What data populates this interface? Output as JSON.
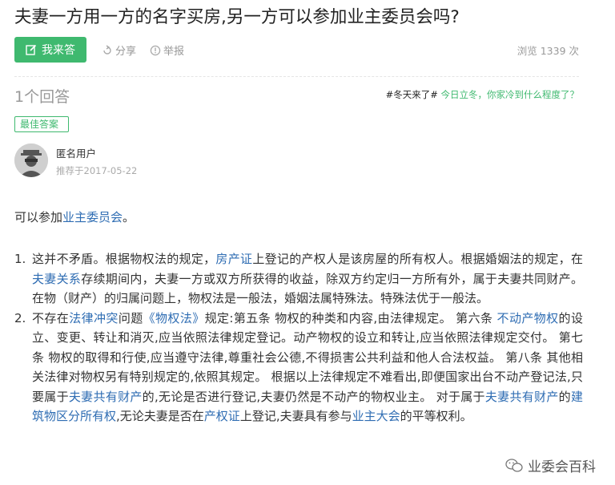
{
  "question": {
    "title": "夫妻一方用一方的名字买房,另一方可以参加业主委员会吗?"
  },
  "toolbar": {
    "answer_label": "我来答",
    "share_label": "分享",
    "report_label": "举报",
    "views_label": "浏览 1339 次"
  },
  "answers": {
    "count_label": "1个回答",
    "topic_tag": "#冬天来了#",
    "topic_link": "今日立冬，你家冷到什么程度了？",
    "best_label": "最佳答案",
    "user": "匿名用户",
    "date": "推荐于2017-05-22"
  },
  "content": {
    "intro_pre": "可以参加",
    "intro_link": "业主委员会",
    "intro_post": "。",
    "item1": {
      "num": "1.",
      "t1": "这并不矛盾。根据物权法的规定，",
      "l1": "房产证",
      "t2": "上登记的产权人是该房屋的所有权人。根据婚姻法的规定，在",
      "l2": "夫妻关系",
      "t3": "存续期间内，夫妻一方或双方所获得的收益，除双方约定归一方所有外，属于夫妻共同财产。在物（财产）的归属问题上，物权法是一般法，婚姻法属特殊法。特殊法优于一般法。"
    },
    "item2": {
      "num": "2.",
      "t1": "不存在",
      "l1": "法律冲突",
      "t2": "问题",
      "l2": "《物权法》",
      "t3": "规定:第五条 物权的种类和内容,由法律规定。 第六条 ",
      "l3": "不动产物权",
      "t4": "的设立、变更、转让和消灭,应当依照法律规定登记。动产物权的设立和转让,应当依照法律规定交付。 第七条 物权的取得和行使,应当遵守法律,尊重社会公德,不得损害公共利益和他人合法权益。 第八条 其他相关法律对物权另有特别规定的,依照其规定。 根据以上法律规定不难看出,即便国家出台不动产登记法,只要属于",
      "l4": "夫妻共有财产",
      "t5": "的,无论是否进行登记,夫妻仍然是不动产的物权业主。 对于属于",
      "l5": "夫妻共有财产",
      "t6": "的",
      "l6": "建筑物区分所有权",
      "t7": ",无论夫妻是否在",
      "l7": "产权证",
      "t8": "上登记,夫妻具有参与",
      "l8": "业主大会",
      "t9": "的平等权利。"
    }
  },
  "watermark": {
    "label": "业委会百科"
  },
  "colors": {
    "accent": "#3fb96f",
    "link": "#2f6db3"
  }
}
